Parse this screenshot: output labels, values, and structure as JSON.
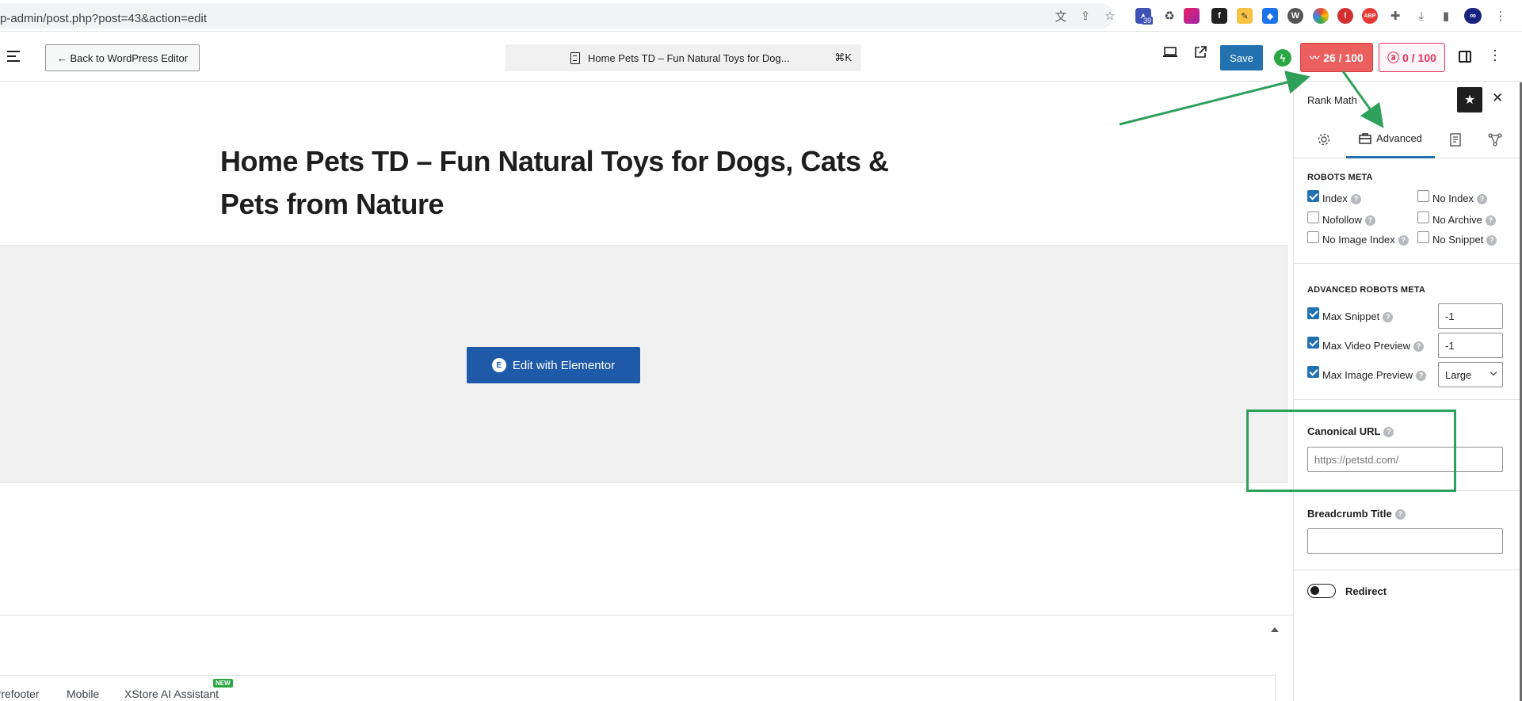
{
  "browser": {
    "url": "p-admin/post.php?post=43&action=edit",
    "ext_badge": "39",
    "extensions": [
      {
        "name": "translate-icon",
        "color": "#5f6368"
      },
      {
        "name": "share-icon",
        "color": "#5f6368"
      },
      {
        "name": "bookmark-star-icon",
        "color": "#5f6368"
      }
    ]
  },
  "editor": {
    "back_label": "← Back to WordPress Editor",
    "doc_title": "Home Pets TD – Fun Natural Toys for Dog...",
    "shortcut": "⌘K",
    "save_label": "Save",
    "seo_score": "26 / 100",
    "content_ai_score": "0 / 100"
  },
  "canvas": {
    "post_title": "Home Pets TD – Fun Natural Toys for Dogs, Cats & Pets from Nature",
    "elementor_button": "Edit with Elementor",
    "bottom_tabs": [
      "Prefooter",
      "Mobile",
      "XStore AI Assistant"
    ],
    "new_badge": "NEW"
  },
  "sidebar": {
    "title": "Rank Math",
    "tabs": [
      {
        "label": "",
        "icon": "gear-icon"
      },
      {
        "label": "Advanced",
        "icon": "briefcase-icon"
      },
      {
        "label": "",
        "icon": "snippet-icon"
      },
      {
        "label": "",
        "icon": "schema-icon"
      }
    ],
    "robots_meta": {
      "header": "ROBOTS META",
      "options": [
        {
          "label": "Index",
          "checked": true
        },
        {
          "label": "No Index",
          "checked": false
        },
        {
          "label": "Nofollow",
          "checked": false
        },
        {
          "label": "No Archive",
          "checked": false
        },
        {
          "label": "No Image Index",
          "checked": false
        },
        {
          "label": "No Snippet",
          "checked": false
        }
      ]
    },
    "advanced_robots": {
      "header": "ADVANCED ROBOTS META",
      "max_snippet": {
        "label": "Max Snippet",
        "value": "-1",
        "checked": true
      },
      "max_video": {
        "label": "Max Video Preview",
        "value": "-1",
        "checked": true
      },
      "max_image": {
        "label": "Max Image Preview",
        "value": "Large",
        "checked": true
      }
    },
    "canonical": {
      "label": "Canonical URL",
      "placeholder": "https://petstd.com/"
    },
    "breadcrumb": {
      "label": "Breadcrumb Title",
      "value": ""
    },
    "redirect": {
      "label": "Redirect",
      "on": false
    }
  },
  "colors": {
    "accent": "#2271b1",
    "seo_score_bg": "#eb5f5f",
    "content_ai": "#e0325f",
    "annotation": "#2ea05a",
    "elementor": "#1e5aa8"
  }
}
